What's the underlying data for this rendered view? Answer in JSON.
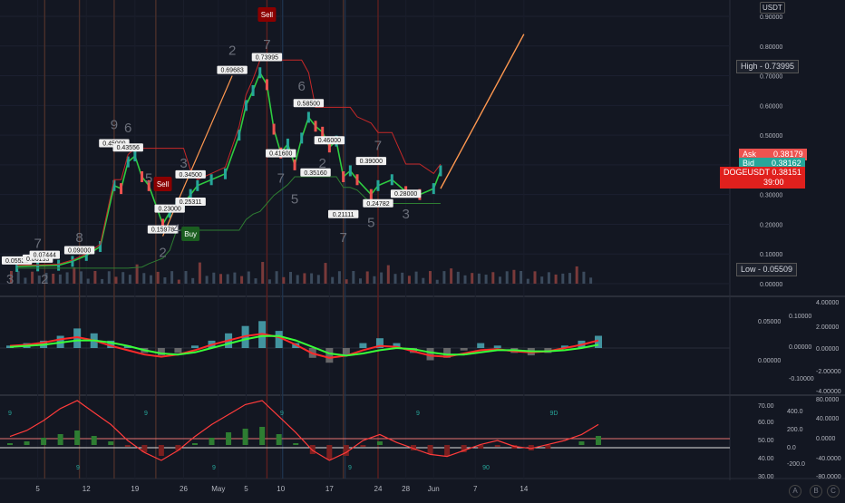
{
  "chart_data": {
    "type": "line",
    "symbol": "DOGEUSDT",
    "currency_badge": "USDT",
    "price_axis": {
      "min": 0.0,
      "max": 0.9,
      "ticks": [
        "0.90000",
        "0.80000",
        "0.70000",
        "0.60000",
        "0.50000",
        "0.40000",
        "0.30000",
        "0.20000",
        "0.10000",
        "0.00000"
      ]
    },
    "x_ticks": [
      "5",
      "12",
      "19",
      "26",
      "May",
      "5",
      "10",
      "17",
      "24",
      "28",
      "Jun",
      "7",
      "14"
    ],
    "price_series": [
      {
        "date": "Apr 2",
        "close": 0.058
      },
      {
        "date": "Apr 5",
        "close": 0.06
      },
      {
        "date": "Apr 8",
        "close": 0.062
      },
      {
        "date": "Apr 10",
        "close": 0.075
      },
      {
        "date": "Apr 12",
        "close": 0.095
      },
      {
        "date": "Apr 14",
        "close": 0.125
      },
      {
        "date": "Apr 16",
        "close": 0.33
      },
      {
        "date": "Apr 17",
        "close": 0.32
      },
      {
        "date": "Apr 18",
        "close": 0.41
      },
      {
        "date": "Apr 19",
        "close": 0.43
      },
      {
        "date": "Apr 20",
        "close": 0.36
      },
      {
        "date": "Apr 21",
        "close": 0.33
      },
      {
        "date": "Apr 23",
        "close": 0.2
      },
      {
        "date": "Apr 24",
        "close": 0.24
      },
      {
        "date": "Apr 25",
        "close": 0.26
      },
      {
        "date": "Apr 26",
        "close": 0.27
      },
      {
        "date": "Apr 27",
        "close": 0.3
      },
      {
        "date": "Apr 28",
        "close": 0.33
      },
      {
        "date": "Apr 30",
        "close": 0.35
      },
      {
        "date": "May 2",
        "close": 0.37
      },
      {
        "date": "May 4",
        "close": 0.5
      },
      {
        "date": "May 5",
        "close": 0.6
      },
      {
        "date": "May 6",
        "close": 0.65
      },
      {
        "date": "May 7",
        "close": 0.71
      },
      {
        "date": "May 8",
        "close": 0.67
      },
      {
        "date": "May 9",
        "close": 0.52
      },
      {
        "date": "May 10",
        "close": 0.44
      },
      {
        "date": "May 11",
        "close": 0.47
      },
      {
        "date": "May 12",
        "close": 0.4
      },
      {
        "date": "May 13",
        "close": 0.49
      },
      {
        "date": "May 14",
        "close": 0.56
      },
      {
        "date": "May 15",
        "close": 0.53
      },
      {
        "date": "May 16",
        "close": 0.51
      },
      {
        "date": "May 17",
        "close": 0.46
      },
      {
        "date": "May 18",
        "close": 0.48
      },
      {
        "date": "May 19",
        "close": 0.36
      },
      {
        "date": "May 20",
        "close": 0.38
      },
      {
        "date": "May 21",
        "close": 0.35
      },
      {
        "date": "May 23",
        "close": 0.3
      },
      {
        "date": "May 24",
        "close": 0.33
      },
      {
        "date": "May 26",
        "close": 0.35
      },
      {
        "date": "May 28",
        "close": 0.31
      },
      {
        "date": "May 30",
        "close": 0.3
      },
      {
        "date": "Jun 1",
        "close": 0.32
      },
      {
        "date": "Jun 2",
        "close": 0.38
      }
    ],
    "projection": [
      {
        "date": "Jun 2",
        "value": 0.32
      },
      {
        "date": "Jun 14",
        "value": 0.84
      }
    ],
    "point_labels": [
      {
        "date": "Apr 2",
        "value": 0.0552,
        "label": "0.05522"
      },
      {
        "date": "Apr 5",
        "value": 0.0613,
        "label": "0.06133"
      },
      {
        "date": "Apr 6",
        "value": 0.0744,
        "label": "0.07444"
      },
      {
        "date": "Apr 11",
        "value": 0.09,
        "label": "0.09000"
      },
      {
        "date": "Apr 16",
        "value": 0.45,
        "label": "0.45000"
      },
      {
        "date": "Apr 18",
        "value": 0.4356,
        "label": "0.43556"
      },
      {
        "date": "Apr 23",
        "value": 0.1597,
        "label": "0.15978"
      },
      {
        "date": "Apr 24",
        "value": 0.23,
        "label": "0.23000"
      },
      {
        "date": "Apr 27",
        "value": 0.2531,
        "label": "0.25311"
      },
      {
        "date": "Apr 27",
        "value": 0.345,
        "label": "0.34500"
      },
      {
        "date": "May 3",
        "value": 0.6968,
        "label": "0.69683"
      },
      {
        "date": "May 8",
        "value": 0.7399,
        "label": "0.73995"
      },
      {
        "date": "May 10",
        "value": 0.416,
        "label": "0.41600"
      },
      {
        "date": "May 14",
        "value": 0.585,
        "label": "0.58500"
      },
      {
        "date": "May 15",
        "value": 0.3516,
        "label": "0.35160"
      },
      {
        "date": "May 17",
        "value": 0.46,
        "label": "0.46000"
      },
      {
        "date": "May 19",
        "value": 0.2111,
        "label": "0.21111"
      },
      {
        "date": "May 23",
        "value": 0.39,
        "label": "0.39000"
      },
      {
        "date": "May 24",
        "value": 0.2478,
        "label": "0.24782"
      },
      {
        "date": "May 28",
        "value": 0.28,
        "label": "0.28000"
      }
    ],
    "wave_counts": [
      {
        "date": "Apr 1",
        "value": 0.0,
        "label": "3"
      },
      {
        "date": "Apr 5",
        "value": 0.12,
        "label": "7"
      },
      {
        "date": "Apr 6",
        "value": 0.0,
        "label": "2"
      },
      {
        "date": "Apr 11",
        "value": 0.14,
        "label": "8"
      },
      {
        "date": "Apr 16",
        "value": 0.52,
        "label": "9"
      },
      {
        "date": "Apr 18",
        "value": 0.51,
        "label": "6"
      },
      {
        "date": "Apr 21",
        "value": 0.34,
        "label": "5"
      },
      {
        "date": "Apr 23",
        "value": 0.09,
        "label": "2"
      },
      {
        "date": "Apr 25",
        "value": 0.17,
        "label": "4"
      },
      {
        "date": "Apr 26",
        "value": 0.39,
        "label": "3"
      },
      {
        "date": "May 3",
        "value": 0.77,
        "label": "2"
      },
      {
        "date": "May 8",
        "value": 0.79,
        "label": "7"
      },
      {
        "date": "May 10",
        "value": 0.34,
        "label": "7"
      },
      {
        "date": "May 12",
        "value": 0.27,
        "label": "5"
      },
      {
        "date": "May 13",
        "value": 0.65,
        "label": "6"
      },
      {
        "date": "May 16",
        "value": 0.39,
        "label": "2"
      },
      {
        "date": "May 19",
        "value": 0.14,
        "label": "7"
      },
      {
        "date": "May 23",
        "value": 0.19,
        "label": "5"
      },
      {
        "date": "May 24",
        "value": 0.45,
        "label": "7"
      },
      {
        "date": "May 28",
        "value": 0.22,
        "label": "3"
      }
    ],
    "signals": [
      {
        "type": "Sell",
        "date": "Apr 23"
      },
      {
        "type": "Buy",
        "date": "Apr 27"
      },
      {
        "type": "Sell",
        "date": "May 8"
      }
    ],
    "right_labels": {
      "high_label": "High",
      "high_value": "0.73995",
      "ask_label": "Ask",
      "ask_value": "0.38179",
      "bid_label": "Bid",
      "bid_value": "0.38162",
      "last_label": "DOGEUSDT",
      "last_value": "0.38151",
      "countdown": "39:00",
      "low_label": "Low",
      "low_value": "0.05509"
    },
    "pane2": {
      "left_ticks": [
        "0.05000",
        "0.00000"
      ],
      "right_ticks": [
        "4.00000",
        "2.00000",
        "0.00000",
        "-2.00000",
        "-4.00000"
      ],
      "inner_ticks": [
        "0.10000",
        "0.00000",
        "-0.10000"
      ],
      "histogram": [
        0.01,
        0.02,
        0.03,
        0.05,
        0.08,
        0.06,
        0.03,
        0.01,
        -0.02,
        -0.03,
        -0.02,
        0.01,
        0.03,
        0.06,
        0.09,
        0.11,
        0.07,
        0.02,
        -0.04,
        -0.06,
        -0.03,
        0.02,
        0.04,
        0.02,
        -0.02,
        -0.05,
        -0.04,
        -0.01,
        0.02,
        0.01,
        -0.02,
        -0.03,
        -0.02,
        0.01,
        0.03,
        0.05
      ],
      "fast_line": [
        0.02,
        0.03,
        0.05,
        0.08,
        0.1,
        0.07,
        0.02,
        -0.02,
        -0.06,
        -0.08,
        -0.06,
        -0.02,
        0.03,
        0.07,
        0.11,
        0.13,
        0.1,
        0.03,
        -0.05,
        -0.09,
        -0.07,
        -0.02,
        0.02,
        0.01,
        -0.03,
        -0.07,
        -0.08,
        -0.05,
        -0.02,
        -0.01,
        -0.03,
        -0.04,
        -0.03,
        0.0,
        0.03,
        0.07
      ],
      "slow_line": [
        0.01,
        0.02,
        0.03,
        0.05,
        0.07,
        0.07,
        0.05,
        0.02,
        -0.02,
        -0.05,
        -0.06,
        -0.04,
        0.0,
        0.04,
        0.08,
        0.11,
        0.11,
        0.07,
        0.01,
        -0.05,
        -0.07,
        -0.05,
        -0.02,
        0.0,
        -0.01,
        -0.04,
        -0.06,
        -0.06,
        -0.04,
        -0.02,
        -0.02,
        -0.03,
        -0.03,
        -0.02,
        0.0,
        0.03
      ]
    },
    "pane3": {
      "left_ticks": [
        "70.00",
        "60.00",
        "50.00",
        "40.00",
        "30.00"
      ],
      "inner_ticks": [
        "400.0",
        "200.0",
        "0.0",
        "-200.0"
      ],
      "right_ticks": [
        "80.0000",
        "40.0000",
        "0.0000",
        "-40.0000",
        "-80.0000"
      ],
      "rsi": [
        52,
        55,
        60,
        66,
        70,
        64,
        58,
        50,
        44,
        40,
        45,
        52,
        58,
        63,
        68,
        70,
        62,
        54,
        45,
        40,
        44,
        50,
        53,
        49,
        46,
        43,
        42,
        45,
        48,
        50,
        47,
        46,
        48,
        50,
        53,
        58
      ],
      "osc": [
        10,
        20,
        40,
        60,
        80,
        50,
        20,
        -10,
        -40,
        -60,
        -30,
        10,
        40,
        70,
        90,
        100,
        60,
        10,
        -50,
        -80,
        -60,
        -10,
        20,
        0,
        -30,
        -50,
        -60,
        -40,
        -20,
        -10,
        -20,
        -30,
        -20,
        0,
        20,
        50
      ],
      "markers": [
        "9",
        "9",
        "9",
        "9",
        "9",
        "9",
        "9",
        "90",
        "9D"
      ]
    },
    "footer_icons": [
      "A",
      "B",
      "C"
    ]
  }
}
